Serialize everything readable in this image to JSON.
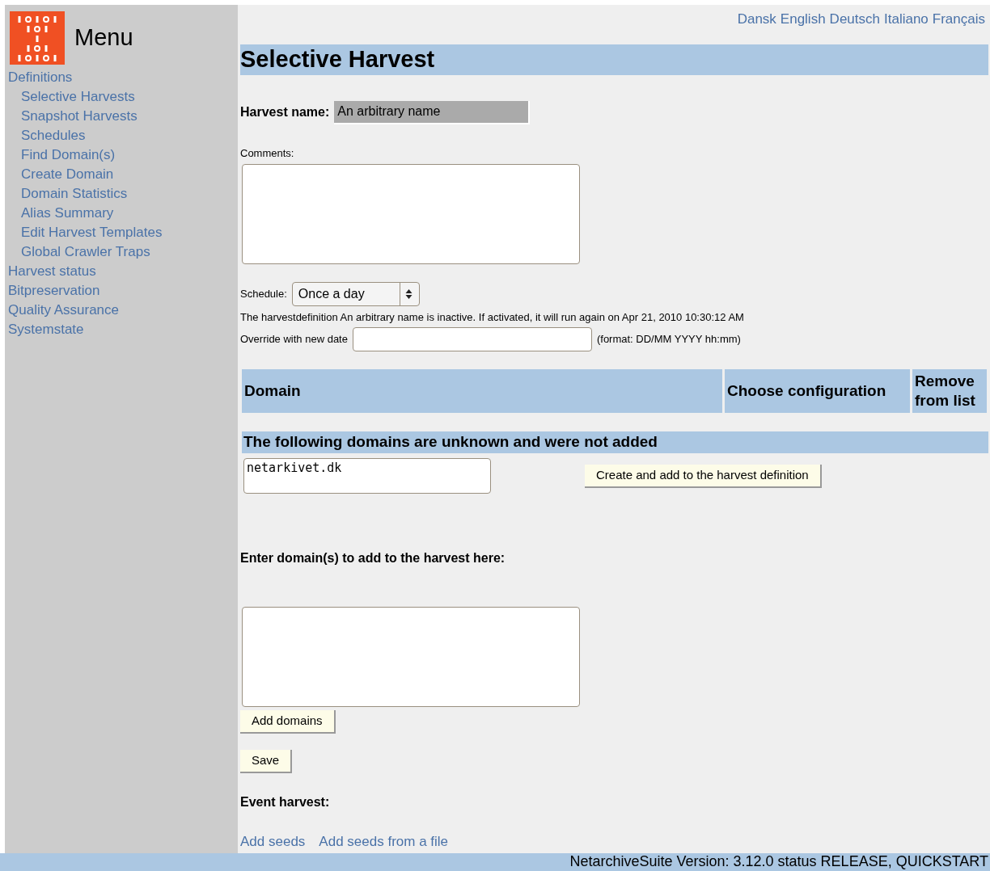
{
  "sidebar": {
    "title": "Menu",
    "items": [
      {
        "label": "Definitions",
        "children": [
          {
            "label": "Selective Harvests"
          },
          {
            "label": "Snapshot Harvests"
          },
          {
            "label": "Schedules"
          },
          {
            "label": "Find Domain(s)"
          },
          {
            "label": "Create Domain"
          },
          {
            "label": "Domain Statistics"
          },
          {
            "label": "Alias Summary"
          },
          {
            "label": "Edit Harvest Templates"
          },
          {
            "label": "Global Crawler Traps"
          }
        ]
      },
      {
        "label": "Harvest status"
      },
      {
        "label": "Bitpreservation"
      },
      {
        "label": "Quality Assurance"
      },
      {
        "label": "Systemstate"
      }
    ]
  },
  "languages": [
    "Dansk",
    "English",
    "Deutsch",
    "Italiano",
    "Français"
  ],
  "title": "Selective Harvest",
  "harvest_name": {
    "label": "Harvest name:",
    "value": "An arbitrary name"
  },
  "comments": {
    "label": "Comments:"
  },
  "schedule": {
    "label": "Schedule:",
    "value": "Once a day"
  },
  "status_text": "The harvestdefinition An arbitrary name is inactive. If activated, it will run again on Apr 21, 2010 10:30:12 AM",
  "override": {
    "label": "Override with new date",
    "hint": "(format: DD/MM YYYY hh:mm)"
  },
  "table": {
    "columns": [
      "Domain",
      "Choose configuration",
      "Remove from list"
    ]
  },
  "unknown": {
    "heading": "The following domains are unknown and were not added",
    "value": "netarkivet.dk",
    "button": "Create and add to the harvest definition"
  },
  "enter_domains": {
    "label": "Enter domain(s) to add to the harvest here:",
    "button": "Add domains"
  },
  "save_button": "Save",
  "event_harvest": {
    "label": "Event harvest:",
    "links": [
      "Add seeds",
      "Add seeds from a file"
    ]
  },
  "footer": "NetarchiveSuite Version: 3.12.0 status RELEASE, QUICKSTART"
}
